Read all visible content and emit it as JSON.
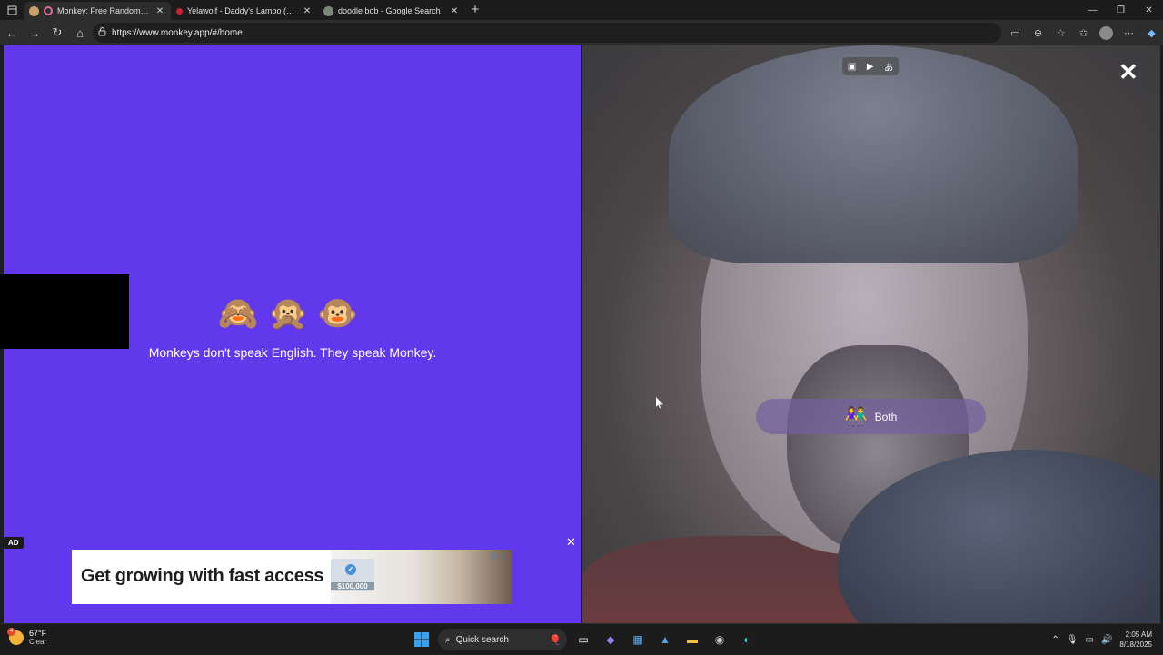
{
  "browser": {
    "tabs": [
      {
        "title": "Monkey: Free Random Video Chat",
        "active": true,
        "favicon_color": "#c9a06a"
      },
      {
        "title": "Yelawolf - Daddy's Lambo (Official",
        "active": false,
        "favicon_color": "#cc1f3a"
      },
      {
        "title": "doodle bob - Google Search",
        "active": false,
        "favicon_color": "#7a8a7a"
      }
    ],
    "url": "https://www.monkey.app/#/home"
  },
  "left_pane": {
    "emojis": "🙈🙊🐵",
    "tagline": "Monkeys don't speak English. They speak Monkey.",
    "ad_label": "AD",
    "ad_close": "✕",
    "ad": {
      "headline": "Get growing with fast access",
      "amount": "$100,000",
      "check": "✓",
      "icons": "▷ ⋮"
    }
  },
  "right_pane": {
    "close": "✕",
    "both_label": "Both",
    "both_emoji": "👫"
  },
  "taskbar": {
    "temperature": "67°F",
    "weather_text": "Clear",
    "weather_badge": "4",
    "search_placeholder": "Quick search",
    "time": "2:05 AM",
    "date": "8/18/2025"
  },
  "colors": {
    "monkey_purple": "#6238ec",
    "chrome_dark": "#1c1c1c"
  }
}
